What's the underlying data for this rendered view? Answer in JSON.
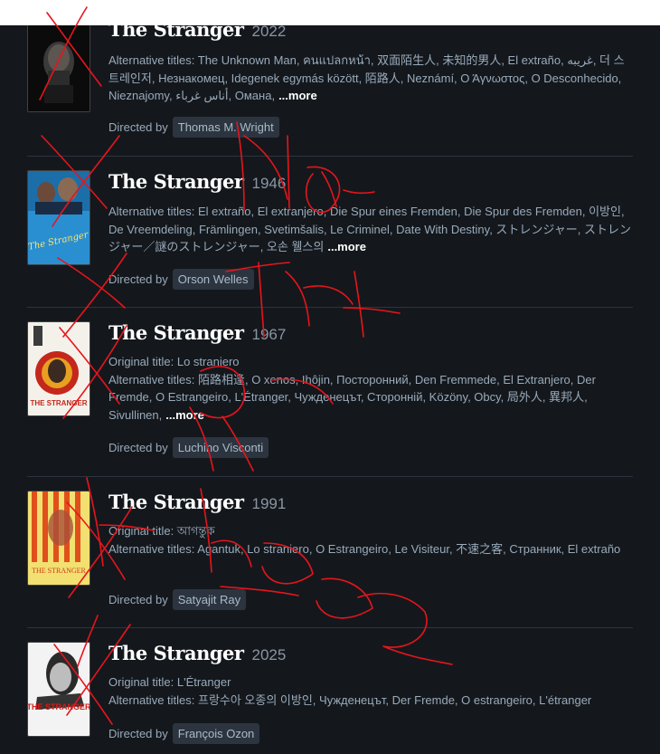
{
  "films": [
    {
      "title": "The Stranger",
      "year": "2022",
      "original_title": "",
      "alternative_titles": "Alternative titles: The Unknown Man, คนแปลกหน้า, 双面陌生人, 未知的男人, El extraño, غريبه, 더 스트레인저, Незнакомец, Idegenek egymás között, 陌路人, Neznámí, Ο Άγνωστος, O Desconhecido, Nieznajomy, أناس غرباء, Омана,",
      "more": "...more",
      "directed_by_label": "Directed by",
      "director": "Thomas M. Wright"
    },
    {
      "title": "The Stranger",
      "year": "1946",
      "original_title": "",
      "alternative_titles": "Alternative titles: El extraño, El extranjero, Die Spur eines Fremden, Die Spur des Fremden, 이방인, De Vreemdeling, Främlingen, Svetimšalis, Le Criminel, Date With Destiny, ストレンジャー, ストレンジャー／謎のストレンジャー, 오손 웰스의",
      "more": "...more",
      "directed_by_label": "Directed by",
      "director": "Orson Welles"
    },
    {
      "title": "The Stranger",
      "year": "1967",
      "original_title": "Original title: Lo straniero",
      "alternative_titles": "Alternative titles: 陌路相逢, O xenos, Ihôjin, Посторонний, Den Fremmede, El Extranjero, Der Fremde, O Estrangeiro, L'Étranger, Чужденецът, Сторонній, Közöny, Obcy, 局外人, 異邦人, Sivullinen,",
      "more": "...more",
      "directed_by_label": "Directed by",
      "director": "Luchino Visconti"
    },
    {
      "title": "The Stranger",
      "year": "1991",
      "original_title": "Original title: আগন্তুক",
      "alternative_titles": "Alternative titles: Agantuk, Lo straniero, O Estrangeiro, Le Visiteur, 不速之客, Странник, El extraño",
      "more": "",
      "directed_by_label": "Directed by",
      "director": "Satyajit Ray"
    },
    {
      "title": "The Stranger",
      "year": "2025",
      "original_title": "Original title: L'Étranger",
      "alternative_titles": "Alternative titles: 프랑수아 오종의 이방인, Чужденецът, Der Fremde, O estrangeiro, L'étranger",
      "more": "",
      "directed_by_label": "Directed by",
      "director": "François Ozon"
    }
  ],
  "posters": [
    {
      "text": ""
    },
    {
      "text": "The Stranger"
    },
    {
      "text": "THE STRANGER"
    },
    {
      "text": "THE STRANGER"
    },
    {
      "text": "THE STRANGER"
    }
  ],
  "colors": {
    "background": "#14181c",
    "title": "#ffffff",
    "muted_text": "#99aabb",
    "director_chip": "#2c3440",
    "scribble": "#e8141c"
  }
}
